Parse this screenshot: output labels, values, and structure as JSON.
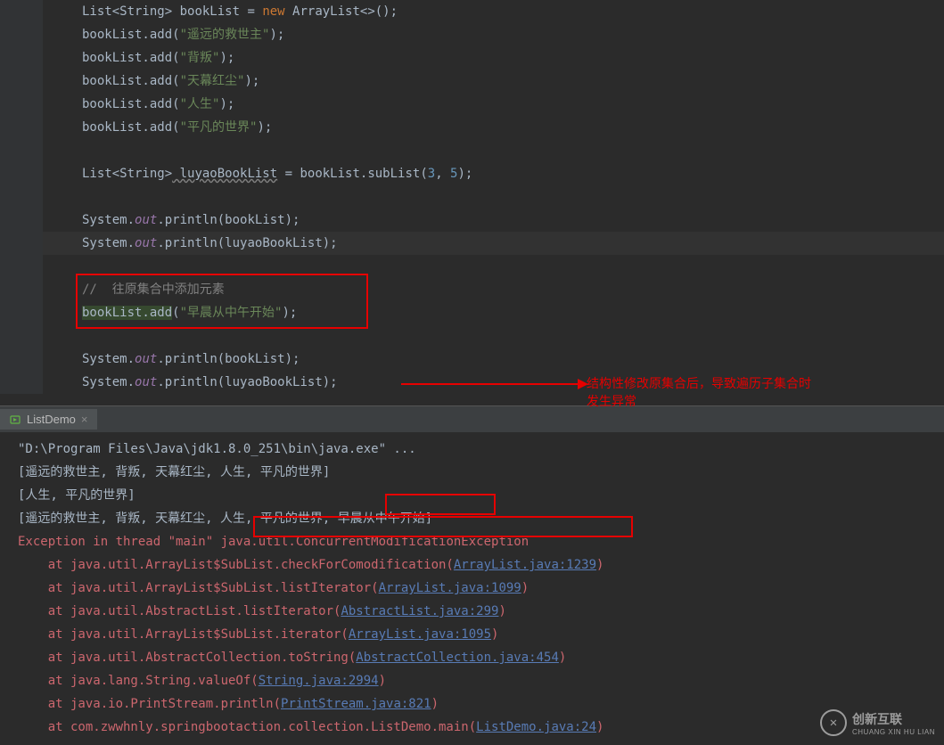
{
  "code": {
    "line1_type1": "List",
    "line1_generic": "<String>",
    "line1_var": " bookList = ",
    "line1_new": "new",
    "line1_ctor": " ArrayList<>();",
    "line2_pre": "bookList.add(",
    "line2_str": "\"遥远的救世主\"",
    "line2_post": ");",
    "line3_str": "\"背叛\"",
    "line4_str": "\"天幕红尘\"",
    "line5_str": "\"人生\"",
    "line6_str": "\"平凡的世界\"",
    "line7_type1": "List",
    "line7_generic": "<String>",
    "line7_var": " luyaoBookList",
    "line7_eq": " = bookList.subList(",
    "line7_n1": "3",
    "line7_c": ", ",
    "line7_n2": "5",
    "line7_post": ");",
    "line8_pre": "System.",
    "line8_out": "out",
    "line8_print": ".println(bookList);",
    "line9_print": ".println(luyaoBookList);",
    "comment": "//  往原集合中添加元素",
    "line10_pre": "bookList.add",
    "line10_open": "(",
    "line10_str": "\"早晨从中午开始\"",
    "line10_post": ");"
  },
  "tab": {
    "name": "ListDemo"
  },
  "console": {
    "line1": "\"D:\\Program Files\\Java\\jdk1.8.0_251\\bin\\java.exe\" ...",
    "line2": "[遥远的救世主, 背叛, 天幕红尘, 人生, 平凡的世界]",
    "line3": "[人生, 平凡的世界]",
    "line4a": "[遥远的救世主, 背叛, 天幕红尘, 人生, 平凡的世界, ",
    "line4b": "早晨从中午开始",
    "line4c": "]",
    "line5a": "Exception in thread \"main\" ",
    "line5b": "java.util.ConcurrentModificationException",
    "stack": [
      {
        "pre": "    at java.util.ArrayList$SubList.checkForComodification(",
        "link": "ArrayList.java:1239",
        "post": ")"
      },
      {
        "pre": "    at java.util.ArrayList$SubList.listIterator(",
        "link": "ArrayList.java:1099",
        "post": ")"
      },
      {
        "pre": "    at java.util.AbstractList.listIterator(",
        "link": "AbstractList.java:299",
        "post": ")"
      },
      {
        "pre": "    at java.util.ArrayList$SubList.iterator(",
        "link": "ArrayList.java:1095",
        "post": ")"
      },
      {
        "pre": "    at java.util.AbstractCollection.toString(",
        "link": "AbstractCollection.java:454",
        "post": ")"
      },
      {
        "pre": "    at java.lang.String.valueOf(",
        "link": "String.java:2994",
        "post": ")"
      },
      {
        "pre": "    at java.io.PrintStream.println(",
        "link": "PrintStream.java:821",
        "post": ")"
      },
      {
        "pre": "    at com.zwwhnly.springbootaction.collection.ListDemo.main(",
        "link": "ListDemo.java:24",
        "post": ")"
      }
    ]
  },
  "annotation": {
    "line1": "结构性修改原集合后，导致遍历子集合时",
    "line2": "发生异常"
  },
  "watermark": {
    "title": "创新互联",
    "subtitle": "CHUANG XIN HU LIAN"
  }
}
